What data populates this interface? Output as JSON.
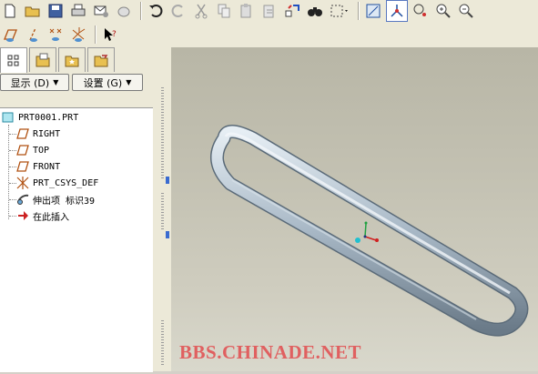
{
  "panel": {
    "display_button": "显示 (D)",
    "settings_button": "设置 (G)"
  },
  "tree": {
    "root": "PRT0001.PRT",
    "items": [
      {
        "label": "RIGHT",
        "icon": "datum-plane-icon"
      },
      {
        "label": "TOP",
        "icon": "datum-plane-icon"
      },
      {
        "label": "FRONT",
        "icon": "datum-plane-icon"
      },
      {
        "label": "PRT_CSYS_DEF",
        "icon": "coordinate-system-icon"
      },
      {
        "label": "伸出项 标识39",
        "icon": "sweep-feature-icon"
      },
      {
        "label": "在此插入",
        "icon": "insert-here-arrow-icon"
      }
    ]
  },
  "watermark": "BBS.CHINADE.NET",
  "colors": {
    "viewport_top": "#b8b6a6",
    "viewport_bottom": "#d9d8cc",
    "model_surface": "#a8b8c6",
    "watermark": "#e06060",
    "insert_arrow": "#cc2222"
  }
}
